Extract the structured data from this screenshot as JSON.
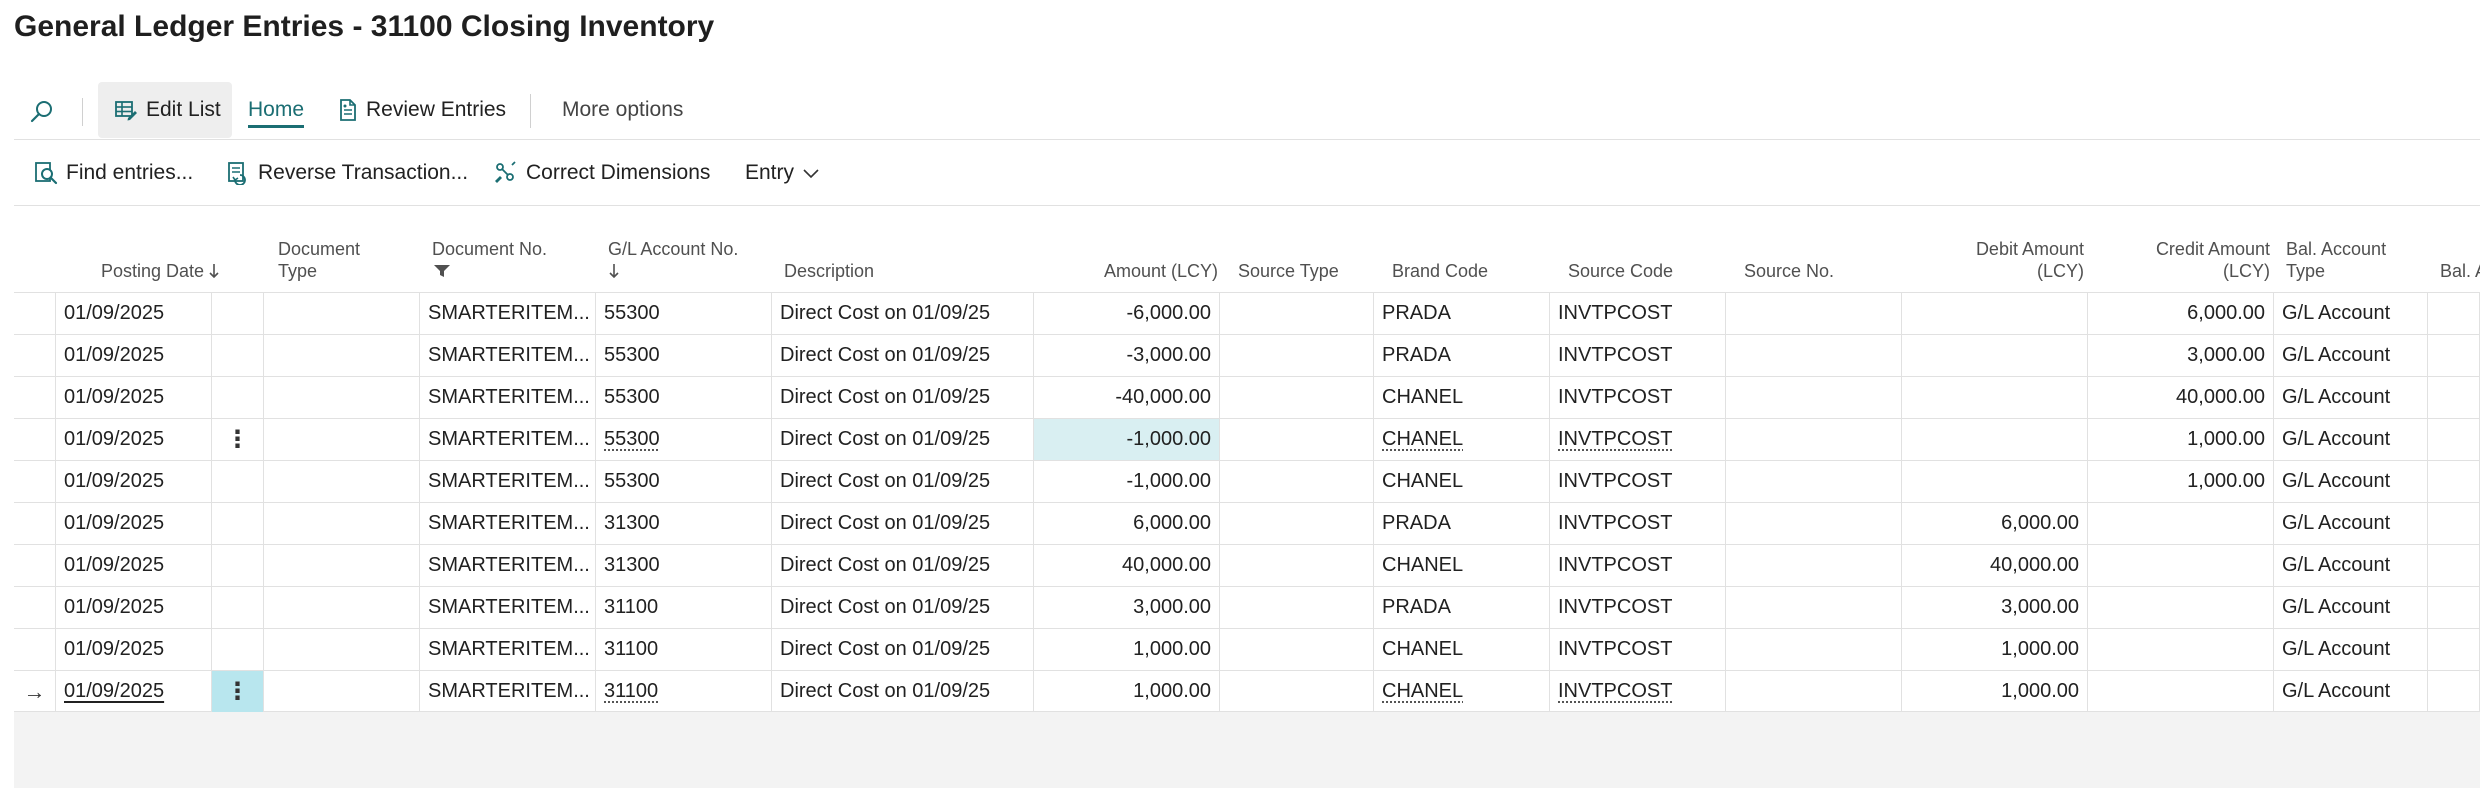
{
  "page": {
    "title": "General Ledger Entries - 31100 Closing Inventory"
  },
  "actionbar": {
    "edit_list": "Edit List",
    "home": "Home",
    "review_entries": "Review Entries",
    "more_options": "More options"
  },
  "subactions": {
    "find_entries": "Find entries...",
    "reverse_transaction": "Reverse Transaction...",
    "correct_dimensions": "Correct Dimensions",
    "entry": "Entry"
  },
  "columns": {
    "posting_date": "Posting Date",
    "document_type_1": "Document",
    "document_type_2": "Type",
    "document_no": "Document No.",
    "gl_account_no": "G/L Account No.",
    "description": "Description",
    "amount": "Amount (LCY)",
    "source_type": "Source Type",
    "brand_code": "Brand Code",
    "source_code": "Source Code",
    "source_no": "Source No.",
    "debit_1": "Debit Amount",
    "debit_2": "(LCY)",
    "credit_1": "Credit Amount",
    "credit_2": "(LCY)",
    "bal_type_1": "Bal. Account",
    "bal_type_2": "Type",
    "bal_cut": "Bal. A"
  },
  "rows": [
    {
      "posting_date": "01/09/2025",
      "document_no": "SMARTERITEM...",
      "gl_account_no": "55300",
      "description": "Direct Cost  on 01/09/25",
      "amount": "-6,000.00",
      "brand_code": "PRADA",
      "source_code": "INVTPCOST",
      "debit": "",
      "credit": "6,000.00",
      "bal_type": "G/L Account"
    },
    {
      "posting_date": "01/09/2025",
      "document_no": "SMARTERITEM...",
      "gl_account_no": "55300",
      "description": "Direct Cost  on 01/09/25",
      "amount": "-3,000.00",
      "brand_code": "PRADA",
      "source_code": "INVTPCOST",
      "debit": "",
      "credit": "3,000.00",
      "bal_type": "G/L Account"
    },
    {
      "posting_date": "01/09/2025",
      "document_no": "SMARTERITEM...",
      "gl_account_no": "55300",
      "description": "Direct Cost  on 01/09/25",
      "amount": "-40,000.00",
      "brand_code": "CHANEL",
      "source_code": "INVTPCOST",
      "debit": "",
      "credit": "40,000.00",
      "bal_type": "G/L Account"
    },
    {
      "posting_date": "01/09/2025",
      "document_no": "SMARTERITEM...",
      "gl_account_no": "55300",
      "description": "Direct Cost  on 01/09/25",
      "amount": "-1,000.00",
      "brand_code": "CHANEL",
      "source_code": "INVTPCOST",
      "debit": "",
      "credit": "1,000.00",
      "bal_type": "G/L Account"
    },
    {
      "posting_date": "01/09/2025",
      "document_no": "SMARTERITEM...",
      "gl_account_no": "55300",
      "description": "Direct Cost  on 01/09/25",
      "amount": "-1,000.00",
      "brand_code": "CHANEL",
      "source_code": "INVTPCOST",
      "debit": "",
      "credit": "1,000.00",
      "bal_type": "G/L Account"
    },
    {
      "posting_date": "01/09/2025",
      "document_no": "SMARTERITEM...",
      "gl_account_no": "31300",
      "description": "Direct Cost  on 01/09/25",
      "amount": "6,000.00",
      "brand_code": "PRADA",
      "source_code": "INVTPCOST",
      "debit": "6,000.00",
      "credit": "",
      "bal_type": "G/L Account"
    },
    {
      "posting_date": "01/09/2025",
      "document_no": "SMARTERITEM...",
      "gl_account_no": "31300",
      "description": "Direct Cost  on 01/09/25",
      "amount": "40,000.00",
      "brand_code": "CHANEL",
      "source_code": "INVTPCOST",
      "debit": "40,000.00",
      "credit": "",
      "bal_type": "G/L Account"
    },
    {
      "posting_date": "01/09/2025",
      "document_no": "SMARTERITEM...",
      "gl_account_no": "31100",
      "description": "Direct Cost  on 01/09/25",
      "amount": "3,000.00",
      "brand_code": "PRADA",
      "source_code": "INVTPCOST",
      "debit": "3,000.00",
      "credit": "",
      "bal_type": "G/L Account"
    },
    {
      "posting_date": "01/09/2025",
      "document_no": "SMARTERITEM...",
      "gl_account_no": "31100",
      "description": "Direct Cost  on 01/09/25",
      "amount": "1,000.00",
      "brand_code": "CHANEL",
      "source_code": "INVTPCOST",
      "debit": "1,000.00",
      "credit": "",
      "bal_type": "G/L Account"
    },
    {
      "posting_date": "01/09/2025",
      "document_no": "SMARTERITEM...",
      "gl_account_no": "31100",
      "description": "Direct Cost  on 01/09/25",
      "amount": "1,000.00",
      "brand_code": "CHANEL",
      "source_code": "INVTPCOST",
      "debit": "1,000.00",
      "credit": "",
      "bal_type": "G/L Account"
    }
  ],
  "icons": {
    "search": "search-icon",
    "edit_list": "edit-list-icon",
    "review": "review-entries-icon",
    "find": "find-entries-icon",
    "reverse": "reverse-transaction-icon",
    "correct": "correct-dimensions-icon",
    "entry_menu": "chevron-down-icon",
    "sort": "sort-down-arrow-icon",
    "filter": "filter-icon",
    "menu": "vertical-ellipsis-icon",
    "current_row": "current-row-arrow-icon"
  },
  "colors": {
    "accent": "#1b6e73",
    "selected_cell": "#d9eff2",
    "selected_menu_cell": "#b8e6ee"
  }
}
